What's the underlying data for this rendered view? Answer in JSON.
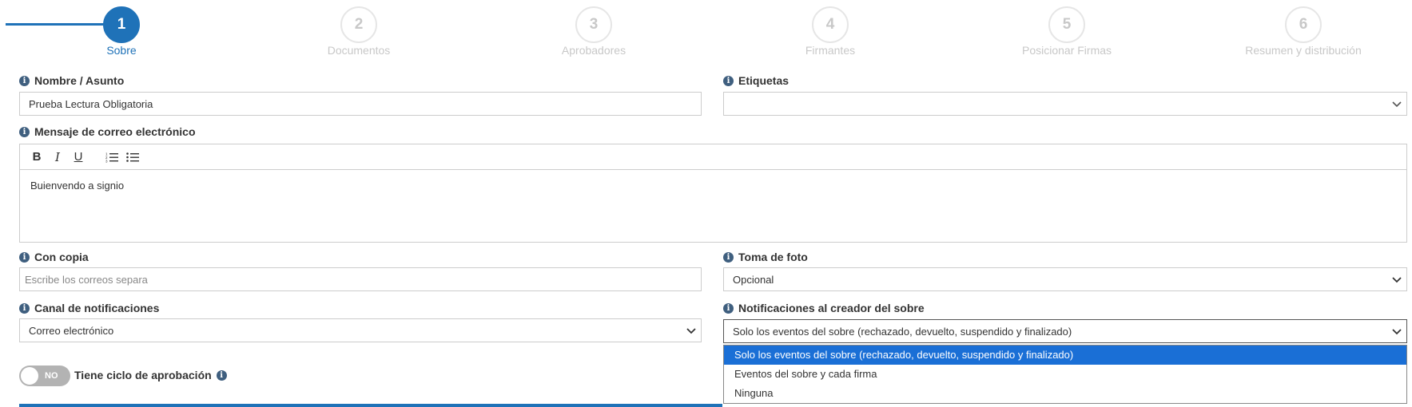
{
  "stepper": {
    "steps": [
      {
        "number": "1",
        "label": "Sobre",
        "active": true
      },
      {
        "number": "2",
        "label": "Documentos"
      },
      {
        "number": "3",
        "label": "Aprobadores"
      },
      {
        "number": "4",
        "label": "Firmantes"
      },
      {
        "number": "5",
        "label": "Posicionar Firmas"
      },
      {
        "number": "6",
        "label": "Resumen y distribución"
      }
    ]
  },
  "form": {
    "nombre": {
      "label": "Nombre / Asunto",
      "value": "Prueba Lectura Obligatoria"
    },
    "etiquetas": {
      "label": "Etiquetas",
      "value": ""
    },
    "mensaje": {
      "label": "Mensaje de correo electrónico",
      "body": "Buienvendo a signio",
      "toolbar": {
        "bold": "B",
        "italic": "I",
        "underline": "U"
      }
    },
    "copia": {
      "label": "Con copia",
      "placeholder": "Escribe los correos separa"
    },
    "foto": {
      "label": "Toma de foto",
      "value": "Opcional"
    },
    "canal": {
      "label": "Canal de notificaciones",
      "value": "Correo electrónico"
    },
    "notif_creador": {
      "label": "Notificaciones al creador del sobre",
      "value": "Solo los eventos del sobre (rechazado, devuelto, suspendido y finalizado)",
      "options": [
        "Solo los eventos del sobre (rechazado, devuelto, suspendido y finalizado)",
        "Eventos del sobre y cada firma",
        "Ninguna"
      ]
    },
    "aprobacion": {
      "toggle_text": "NO",
      "label": "Tiene ciclo de aprobación"
    }
  },
  "icons": {
    "info": "i"
  },
  "colors": {
    "accent": "#1f72b8",
    "selected_option": "#1a6fd6",
    "toggle_off": "#b3b3b3"
  }
}
